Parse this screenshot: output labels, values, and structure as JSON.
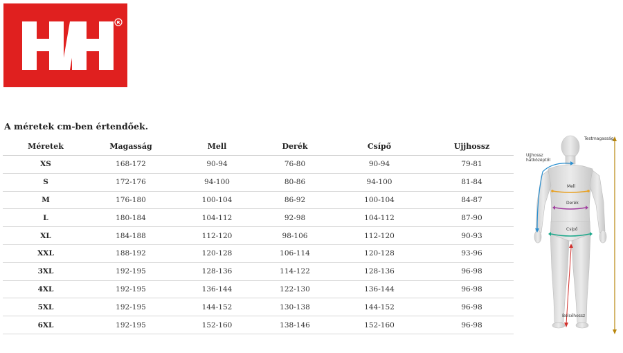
{
  "brand": {
    "logo_text": "H/H",
    "registered_mark": "®",
    "color": "#e0201f"
  },
  "note": "A méretek cm-ben értendőek.",
  "table": {
    "headers": [
      "Méretek",
      "Magasság",
      "Mell",
      "Derék",
      "Csípő",
      "Ujjhossz"
    ],
    "rows": [
      [
        "XS",
        "168-172",
        "90-94",
        "76-80",
        "90-94",
        "79-81"
      ],
      [
        "S",
        "172-176",
        "94-100",
        "80-86",
        "94-100",
        "81-84"
      ],
      [
        "M",
        "176-180",
        "100-104",
        "86-92",
        "100-104",
        "84-87"
      ],
      [
        "L",
        "180-184",
        "104-112",
        "92-98",
        "104-112",
        "87-90"
      ],
      [
        "XL",
        "184-188",
        "112-120",
        "98-106",
        "112-120",
        "90-93"
      ],
      [
        "XXL",
        "188-192",
        "120-128",
        "106-114",
        "120-128",
        "93-96"
      ],
      [
        "3XL",
        "192-195",
        "128-136",
        "114-122",
        "128-136",
        "96-98"
      ],
      [
        "4XL",
        "192-195",
        "136-144",
        "122-130",
        "136-144",
        "96-98"
      ],
      [
        "5XL",
        "192-195",
        "144-152",
        "130-138",
        "144-152",
        "96-98"
      ],
      [
        "6XL",
        "192-195",
        "152-160",
        "138-146",
        "152-160",
        "96-98"
      ]
    ]
  },
  "figure": {
    "labels": {
      "height": "Testmagasság",
      "sleeve_line1": "Ujjhossz",
      "sleeve_line2": "hátközéptől",
      "chest": "Mell",
      "waist": "Derék",
      "hip": "Csípő",
      "inseam": "Belsőhossz"
    },
    "colors": {
      "height": "#b8860b",
      "sleeve": "#2a8fd0",
      "chest": "#e8a020",
      "waist": "#a03c9e",
      "hip": "#1aa88a",
      "inseam": "#d0302c"
    }
  }
}
